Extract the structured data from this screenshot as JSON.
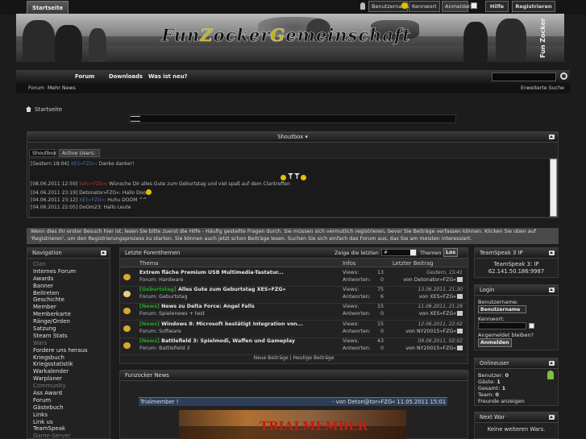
{
  "topbar": {
    "username_placeholder": "Benutzername",
    "password_placeholder": "Kennwort",
    "login_button": "Anmelden",
    "help": "Hilfe",
    "register": "Registrieren"
  },
  "banner": {
    "logo_part1": "Fun",
    "logo_part2": "Z",
    "logo_part3": "ocker",
    "logo_part4": "G",
    "logo_part5": "emeinschaft",
    "side": "Fun Zocker"
  },
  "nav": {
    "tabs": [
      "Startseite",
      "Forum",
      "Downloads",
      "Was ist neu?"
    ],
    "sub_links": [
      "Forum",
      "Mehr News"
    ],
    "advanced_search": "Erweiterte Suche"
  },
  "breadcrumb": {
    "home": "Startseite"
  },
  "shoutbox": {
    "title": "Shoutbox",
    "tab_shoutbox": "Shoutbox",
    "tab_active": "Active Users: 0",
    "messages": [
      {
        "time": "[Gestern 18:04]",
        "user": "XES»FZG«",
        "text": ": Danke danke!!"
      },
      {
        "time": "[08.06.2011 12:59]",
        "user": "Sehr»FZG«",
        "text": ": Wünsche Dir alles Gute zum Geburtstag und viel spaß auf dem Clantreffen"
      },
      {
        "time": "[04.06.2011 23:19]",
        "user": "Detonator»FZG«",
        "text": ": Hallo Doom"
      },
      {
        "time": "[04.06.2011 23:12]",
        "user": "XES»FZG«",
        "text": ": Huhu DOOM ^^"
      },
      {
        "time": "[04.06.2011 22:05]",
        "user": "DoOm23",
        "text": ": Hallo Leute"
      }
    ]
  },
  "notice": "Wenn dies Ihr erster Besuch hier ist, lesen Sie bitte zuerst die Hilfe - Häufig gestellte Fragen durch. Sie müssen sich vermutlich registrieren, bevor Sie Beiträge verfassen können. Klicken Sie oben auf 'Registrieren', um den Registrierungsprozess zu starten. Sie können auch jetzt schon Beiträge lesen. Suchen Sie sich einfach das Forum aus, das Sie am meisten interessiert.",
  "navigation": {
    "title": "Navigation",
    "items": [
      {
        "label": "Clan",
        "cat": true
      },
      {
        "label": "Internes Forum"
      },
      {
        "label": "Awards"
      },
      {
        "label": "Banner"
      },
      {
        "label": "Beitreten"
      },
      {
        "label": "Geschichte"
      },
      {
        "label": "Member"
      },
      {
        "label": "Memberkarte"
      },
      {
        "label": "Ränge/Orden"
      },
      {
        "label": "Satzung"
      },
      {
        "label": "Steam Stats"
      },
      {
        "label": "Wars",
        "cat": true
      },
      {
        "label": "Fordere uns heraus"
      },
      {
        "label": "Kriegsbuch"
      },
      {
        "label": "Kriegsstatistik"
      },
      {
        "label": "Warkalender"
      },
      {
        "label": "Warplaner"
      },
      {
        "label": "Community",
        "cat": true
      },
      {
        "label": "Ass Award"
      },
      {
        "label": "Forum"
      },
      {
        "label": "Gästebuch"
      },
      {
        "label": "Links"
      },
      {
        "label": "Link us"
      },
      {
        "label": "TeamSpeak"
      },
      {
        "label": "Game-Server",
        "cat": true
      }
    ]
  },
  "latest": {
    "title": "Letzte Forenthemen",
    "show_label": "Zeige die letzten",
    "count_value": "#",
    "themes_label": "Themen",
    "los": "Los",
    "col_topic": "Thema",
    "col_info": "Infos",
    "col_last": "Letzter Beitrag",
    "views_label": "Views:",
    "answers_label": "Antworten:",
    "by_prefix": "von",
    "forum_prefix": "Forum:",
    "rows": [
      {
        "prefix": "",
        "title": "Extrem fläche Premium USB Multimedia-Tastatur...",
        "forum": "Hardware",
        "views": "13",
        "answers": "0",
        "date": "Gestern, 15:41",
        "user": "Detonator»FZG«"
      },
      {
        "prefix": "[Geburtstag]",
        "title": "Alles Gute zum Geburtstag XES»FZG«",
        "forum": "Geburtstag",
        "views": "75",
        "answers": "6",
        "date": "13.06.2011, 21:30",
        "user": "XES»FZG«"
      },
      {
        "prefix": "[News]",
        "title": "News zu Delta Force: Angel Falls",
        "forum": "Spielenews + test",
        "views": "15",
        "answers": "0",
        "date": "11.06.2011, 21:29",
        "user": "XES»FZG«"
      },
      {
        "prefix": "[News]",
        "title": "Windows 8: Microsoft bestätigt Integration von...",
        "forum": "Software",
        "views": "15",
        "answers": "0",
        "date": "12.06.2011, 22:02",
        "user": "NY20015»FZG«"
      },
      {
        "prefix": "[News]",
        "title": "Battlefield 3: Spielmodi, Waffen und Gameplay",
        "forum": "Battlefield 3",
        "views": "43",
        "answers": "0",
        "date": "09.06.2011, 02:02",
        "user": "NY20015»FZG«"
      }
    ],
    "footer_new": "Neue Beiträge",
    "footer_sep": "|",
    "footer_today": "Heutige Beiträge"
  },
  "news": {
    "title": "Funzocker News",
    "item_title": "Trialmember !",
    "item_meta": "- von Deton@tor»FZG« 11.05.2011 15:01",
    "image_text": "TRIALMEMBER"
  },
  "teamspeak": {
    "title": "TeamSpeak 3 IP",
    "line1": "TeamSpeak 3: IP",
    "line2": "62.141.50.186:9987"
  },
  "login": {
    "title": "Login",
    "username_label": "Benutzername:",
    "username_value": "Benutzername",
    "password_label": "Kennwort:",
    "remember_label": "Angemeldet bleiben?",
    "submit": "Anmelden"
  },
  "online": {
    "title": "Onlineuser",
    "members_label": "Benutzer:",
    "members": "0",
    "guests_label": "Gäste:",
    "guests": "1",
    "total_label": "Gesamt:",
    "total": "1",
    "team_label": "Team:",
    "team": "0",
    "friends": "Freunde anzeigen"
  },
  "nextwar": {
    "title": "Next War",
    "text": "Keine weiteren Wars."
  },
  "colors": {
    "link": "#4c6fb3",
    "accent_yellow": "#c8b400",
    "background": "#1c1c1c"
  }
}
